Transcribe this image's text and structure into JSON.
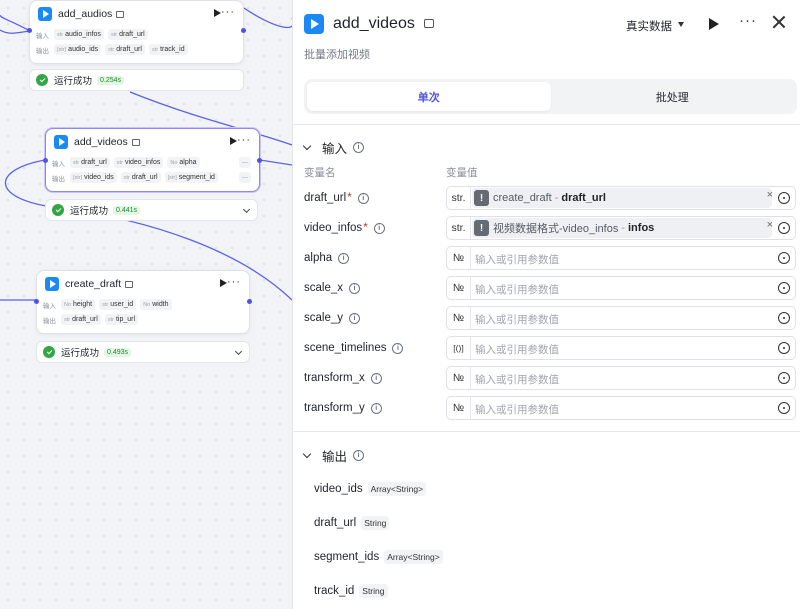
{
  "canvas": {
    "nodes": [
      {
        "title": "add_audios",
        "input_label": "输入",
        "inputs": [
          {
            "type": "str",
            "name": "audio_infos"
          },
          {
            "type": "str",
            "name": "draft_url"
          }
        ],
        "output_label": "输出",
        "outputs": [
          {
            "type": "[str]",
            "name": "audio_ids"
          },
          {
            "type": "str",
            "name": "draft_url"
          },
          {
            "type": "str",
            "name": "track_id"
          }
        ],
        "status": "运行成功",
        "time": "0.254s"
      },
      {
        "title": "add_videos",
        "input_label": "输入",
        "inputs": [
          {
            "type": "str",
            "name": "draft_url"
          },
          {
            "type": "str",
            "name": "video_infos"
          },
          {
            "type": "No",
            "name": "alpha"
          }
        ],
        "output_label": "输出",
        "outputs": [
          {
            "type": "[str]",
            "name": "video_ids"
          },
          {
            "type": "str",
            "name": "draft_url"
          },
          {
            "type": "[str]",
            "name": "segment_id"
          }
        ],
        "more": "···",
        "status": "运行成功",
        "time": "0.441s"
      },
      {
        "title": "create_draft",
        "input_label": "输入",
        "inputs": [
          {
            "type": "No",
            "name": "height"
          },
          {
            "type": "str",
            "name": "user_id"
          },
          {
            "type": "No",
            "name": "width"
          }
        ],
        "output_label": "输出",
        "outputs": [
          {
            "type": "str",
            "name": "draft_url"
          },
          {
            "type": "str",
            "name": "tip_url"
          }
        ],
        "status": "运行成功",
        "time": "0.493s"
      }
    ]
  },
  "panel": {
    "title": "add_videos",
    "subtitle": "批量添加视频",
    "mode": "真实数据",
    "more": "···",
    "tabs": [
      {
        "label": "单次",
        "active": true
      },
      {
        "label": "批处理",
        "active": false
      }
    ],
    "input_section": {
      "title": "输入",
      "col_name": "变量名",
      "col_value": "变量值",
      "rows": [
        {
          "name": "draft_url",
          "required": "*",
          "type": "str.",
          "ref_source": "create_draft",
          "ref_sep": "-",
          "ref_var": "draft_url",
          "clear": "×"
        },
        {
          "name": "video_infos",
          "required": "*",
          "type": "str.",
          "ref_source": "视频数据格式-video_infos",
          "ref_sep": "-",
          "ref_var": "infos",
          "clear": "×"
        },
        {
          "name": "alpha",
          "type": "№",
          "placeholder": "输入或引用参数值"
        },
        {
          "name": "scale_x",
          "type": "№",
          "placeholder": "输入或引用参数值"
        },
        {
          "name": "scale_y",
          "type": "№",
          "placeholder": "输入或引用参数值"
        },
        {
          "name": "scene_timelines",
          "type": "[()]",
          "placeholder": "输入或引用参数值"
        },
        {
          "name": "transform_x",
          "type": "№",
          "placeholder": "输入或引用参数值"
        },
        {
          "name": "transform_y",
          "type": "№",
          "placeholder": "输入或引用参数值"
        }
      ]
    },
    "output_section": {
      "title": "输出",
      "rows": [
        {
          "name": "video_ids",
          "type": "Array<String>"
        },
        {
          "name": "draft_url",
          "type": "String"
        },
        {
          "name": "segment_ids",
          "type": "Array<String>"
        },
        {
          "name": "track_id",
          "type": "String"
        }
      ]
    },
    "colors": {
      "accent": "#4d53e8",
      "success": "#32a645",
      "node_icon": "#1a88f5"
    }
  }
}
